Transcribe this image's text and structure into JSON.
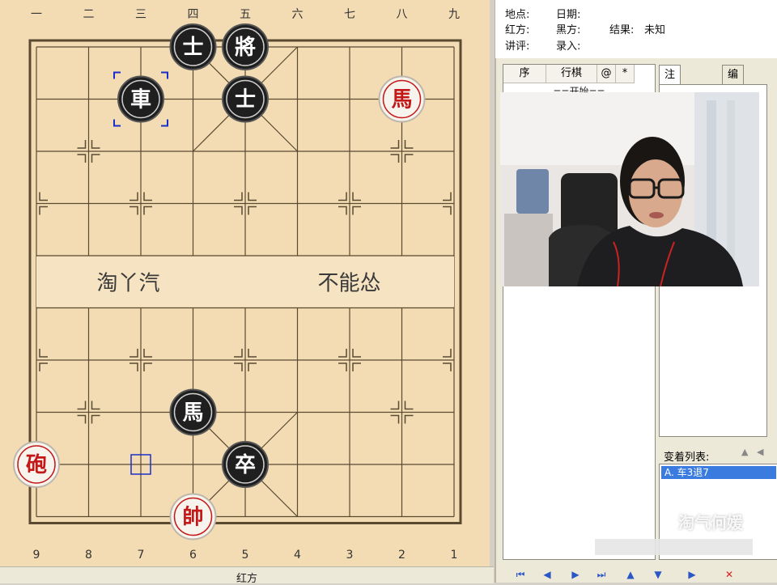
{
  "board": {
    "top_numbers": [
      "一",
      "二",
      "三",
      "四",
      "五",
      "六",
      "七",
      "八",
      "九"
    ],
    "bottom_numbers": [
      "9",
      "8",
      "7",
      "6",
      "5",
      "4",
      "3",
      "2",
      "1"
    ],
    "river_left": "淘丫汽",
    "river_right": "不能怂",
    "pieces": [
      {
        "label": "士",
        "side": "black",
        "file": 3,
        "rank": 0
      },
      {
        "label": "將",
        "side": "black",
        "file": 4,
        "rank": 0
      },
      {
        "label": "車",
        "side": "black",
        "file": 2,
        "rank": 1
      },
      {
        "label": "士",
        "side": "black",
        "file": 4,
        "rank": 1
      },
      {
        "label": "馬",
        "side": "red",
        "file": 7,
        "rank": 1
      },
      {
        "label": "馬",
        "side": "black",
        "file": 3,
        "rank": 7
      },
      {
        "label": "卒",
        "side": "black",
        "file": 4,
        "rank": 8
      },
      {
        "label": "砲",
        "side": "red",
        "file": 0,
        "rank": 8
      },
      {
        "label": "帥",
        "side": "red",
        "file": 3,
        "rank": 9
      }
    ],
    "colors": {
      "board": "#f3dcb3",
      "line": "#5a4a32",
      "red": "#c41818",
      "black": "#1a1a1a",
      "select": "#1a2ec8"
    }
  },
  "bottom_label": "红方",
  "info": {
    "place_label": "地点:",
    "date_label": "日期:",
    "red_label": "红方:",
    "black_label": "黑方:",
    "result_label": "结果:",
    "result_value": "未知",
    "comment_label": "讲评:",
    "entry_label": "录入:"
  },
  "movelist": {
    "headers": [
      "序",
      "行棋",
      "@",
      "*"
    ],
    "start": "==开始=="
  },
  "tabs": [
    "注解查看",
    "编辑"
  ],
  "variations": {
    "label": "变着列表:",
    "items": [
      "A. 车3退7"
    ]
  },
  "watermark": "淘气何媛",
  "toolbar": {
    "icons": [
      "first-icon",
      "prev-icon",
      "next-icon",
      "last-icon",
      "up-icon",
      "down-icon",
      "play-icon",
      "delete-icon"
    ],
    "glyphs": [
      "⏮",
      "◀",
      "▶",
      "⏭",
      "▲",
      "▼",
      "▶",
      "✕"
    ]
  }
}
